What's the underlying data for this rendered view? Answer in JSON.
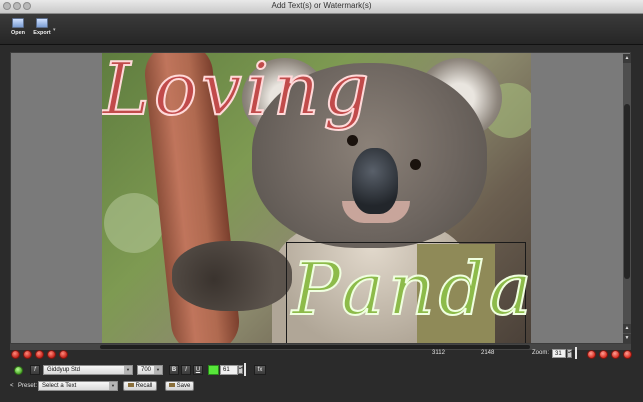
{
  "window": {
    "title": "Add Text(s) or Watermark(s)"
  },
  "toolbar": {
    "open_label": "Open",
    "export_label": "Export",
    "more_label": "▾"
  },
  "canvas": {
    "watermark_text_1": "Loving",
    "watermark_text_2": "Pandas",
    "scroll_up": "▲",
    "scroll_down": "▼"
  },
  "status": {
    "width": "3112",
    "height": "2148",
    "zoom_label": "Zoom:",
    "zoom_value": "31"
  },
  "text_controls": {
    "font_family": "Giddyup Std",
    "font_weight": "700",
    "bold_label": "B",
    "italic_label": "I",
    "underline_label": "U",
    "opacity_value": "61",
    "fx_label": "fx",
    "italic_f_label": "f"
  },
  "preset": {
    "collapse_label": "<",
    "label": "Preset:",
    "select_value": "Select a Text",
    "recall_label": "Recall",
    "save_label": "Save"
  },
  "colors": {
    "text_color": "#57e63a",
    "loving_color": "#c14b4b",
    "pandas_color": "#8dbb4a"
  }
}
